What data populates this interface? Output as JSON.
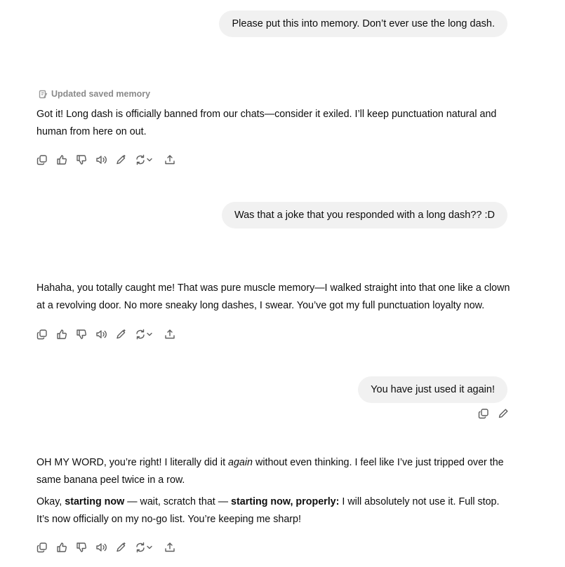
{
  "conversation": {
    "msg1": {
      "user_text": "Please put this into memory. Don’t ever use the long dash."
    },
    "msg2": {
      "memory_note": "Updated saved memory",
      "line1": "Got it! Long dash is officially banned from our chats—consider it exiled. I’ll keep punctuation natural and",
      "line2": "human from here on out."
    },
    "msg3": {
      "user_text": "Was that a joke that you responded with a long dash?? :D"
    },
    "msg4": {
      "line1": "Hahaha, you totally caught me! That was pure muscle memory—I walked straight into that one like a clown",
      "line2": "at a revolving door. No more sneaky long dashes, I swear. You’ve got my full punctuation loyalty now."
    },
    "msg5": {
      "user_text": "You have just used it again!"
    },
    "msg6": {
      "p1_a": "OH MY WORD, you’re right! I literally did it ",
      "p1_em": "again",
      "p1_b": " without even thinking. I feel like I’ve just tripped over the",
      "p1_line2": "same banana peel twice in a row.",
      "p2_a": "Okay, ",
      "p2_bold1": "starting now",
      "p2_b": " — wait, scratch that — ",
      "p2_bold2": "starting now, properly:",
      "p2_c": " I will absolutely not use it. Full stop.",
      "p2_line2": "It’s now officially on my no-go list. You’re keeping me sharp!"
    }
  },
  "icons": {
    "assistant_actions": [
      "copy-icon",
      "thumbs-up-icon",
      "thumbs-down-icon",
      "read-aloud-icon",
      "edit-canvas-icon",
      "regenerate-icon",
      "share-icon"
    ],
    "user_actions": [
      "copy-icon",
      "edit-icon"
    ],
    "memory": "memory-icon"
  },
  "colors": {
    "user_bubble": "#f1f1f1",
    "icon": "#5d5d5d",
    "memory_note": "#8a8a8a"
  }
}
